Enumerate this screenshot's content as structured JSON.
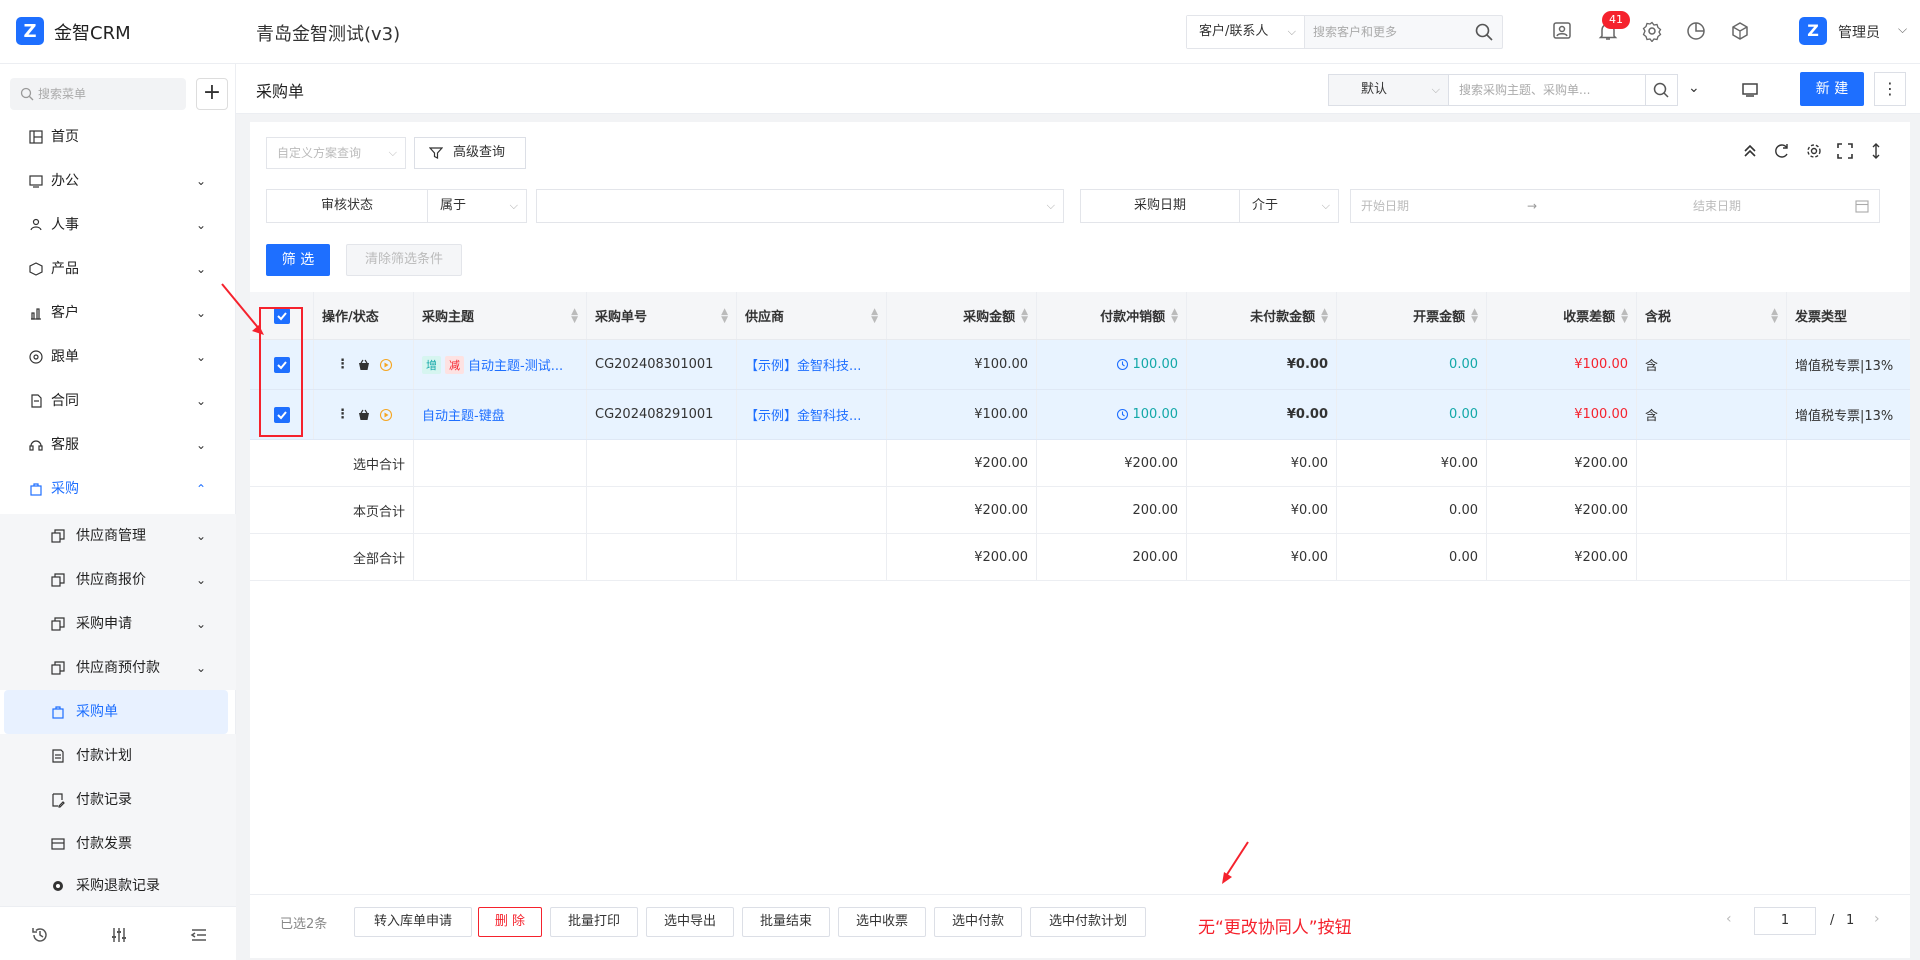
{
  "app": {
    "brand": "金智CRM",
    "company": "青岛金智测试(v3)",
    "logo_glyph": "Z"
  },
  "global_search": {
    "type_label": "客户/联系人",
    "placeholder": "搜索客户和更多"
  },
  "notifications": {
    "count": "41"
  },
  "user": {
    "name": "管理员",
    "avatar_glyph": "Z"
  },
  "sidebar": {
    "search_placeholder": "搜索菜单",
    "add_label": "+",
    "items": [
      {
        "label": "首页",
        "icon": "home-icon"
      },
      {
        "label": "办公",
        "icon": "office-icon"
      },
      {
        "label": "人事",
        "icon": "people-icon"
      },
      {
        "label": "产品",
        "icon": "product-icon"
      },
      {
        "label": "客户",
        "icon": "customer-icon"
      },
      {
        "label": "跟单",
        "icon": "follow-icon"
      },
      {
        "label": "合同",
        "icon": "contract-icon"
      },
      {
        "label": "客服",
        "icon": "service-icon"
      },
      {
        "label": "采购",
        "icon": "purchase-icon"
      }
    ],
    "subitems": [
      {
        "label": "供应商管理",
        "icon": "copy-icon"
      },
      {
        "label": "供应商报价",
        "icon": "copy-icon"
      },
      {
        "label": "采购申请",
        "icon": "copy-icon"
      },
      {
        "label": "供应商预付款",
        "icon": "copy-icon"
      },
      {
        "label": "采购单",
        "icon": "bag-icon"
      },
      {
        "label": "付款计划",
        "icon": "doc-icon"
      },
      {
        "label": "付款记录",
        "icon": "edit-doc-icon"
      },
      {
        "label": "付款发票",
        "icon": "invoice-icon"
      },
      {
        "label": "采购退款记录",
        "icon": "refund-icon"
      }
    ]
  },
  "page": {
    "title": "采购单",
    "view_label": "默认",
    "search_placeholder": "搜索采购主题、采购单...",
    "new_label": "新 建",
    "more_label": "⋮"
  },
  "filters": {
    "custom_scheme_placeholder": "自定义方案查询",
    "advanced_label": "高级查询",
    "f1_field": "审核状态",
    "f1_op": "属于",
    "f2_field": "采购日期",
    "f2_op": "介于",
    "date_start": "开始日期",
    "date_arrow": "→",
    "date_end": "结束日期",
    "filter_label": "筛 选",
    "clear_label": "清除筛选条件"
  },
  "table": {
    "headers": [
      "操作/状态",
      "采购主题",
      "采购单号",
      "供应商",
      "采购金额",
      "付款冲销额",
      "未付款金额",
      "开票金额",
      "收票差额",
      "含税",
      "发票类型"
    ],
    "rows": [
      {
        "tag1": "增",
        "tag2": "减",
        "subject": "自动主题-测试...",
        "number": "CG202408301001",
        "supplier": "【示例】金智科技...",
        "amount": "¥100.00",
        "paid": "100.00",
        "unpaid": "¥0.00",
        "invoiced": "0.00",
        "diff": "¥100.00",
        "tax": "含",
        "invoice_type": "增值税专票|13%"
      },
      {
        "subject": "自动主题-键盘",
        "number": "CG202408291001",
        "supplier": "【示例】金智科技...",
        "amount": "¥100.00",
        "paid": "100.00",
        "unpaid": "¥0.00",
        "invoiced": "0.00",
        "diff": "¥100.00",
        "tax": "含",
        "invoice_type": "增值税专票|13%"
      }
    ],
    "summaries": [
      {
        "label": "选中合计",
        "amount": "¥200.00",
        "paid": "¥200.00",
        "unpaid": "¥0.00",
        "invoiced": "¥0.00",
        "diff": "¥200.00"
      },
      {
        "label": "本页合计",
        "amount": "¥200.00",
        "paid": "200.00",
        "unpaid": "¥0.00",
        "invoiced": "0.00",
        "diff": "¥200.00"
      },
      {
        "label": "全部合计",
        "amount": "¥200.00",
        "paid": "200.00",
        "unpaid": "¥0.00",
        "invoiced": "0.00",
        "diff": "¥200.00"
      }
    ]
  },
  "footer": {
    "selected": "已选2条",
    "buttons": [
      "转入库单申请",
      "删 除",
      "批量打印",
      "选中导出",
      "批量结束",
      "选中收票",
      "选中付款",
      "选中付款计划"
    ],
    "note": "无“更改协同人”按钮",
    "page_current": "1",
    "page_sep": "/",
    "page_total": "1",
    "prev": "‹",
    "next": "›"
  },
  "colors": {
    "accent": "#1e6fff",
    "danger": "#f5222d",
    "teal": "#13a8a8",
    "selected_row": "#e8f3ff"
  }
}
